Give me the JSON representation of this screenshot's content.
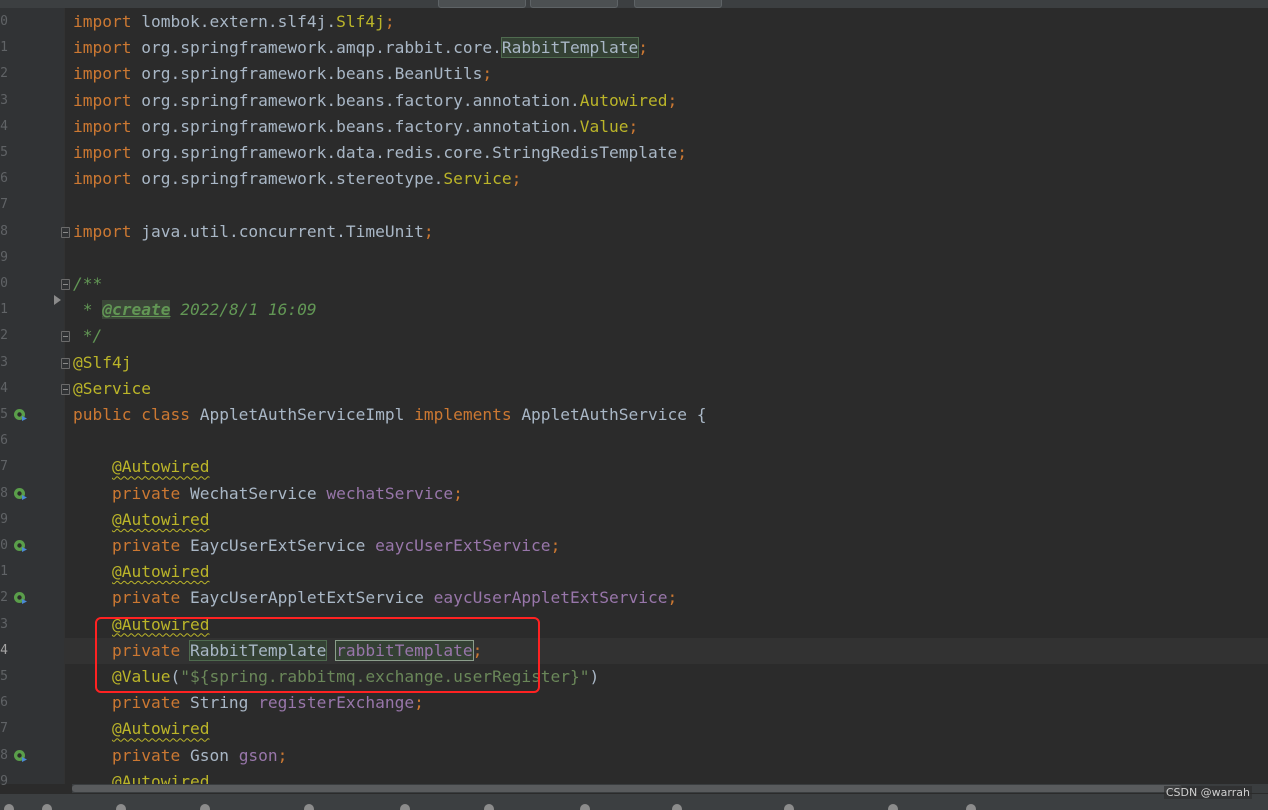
{
  "editor": {
    "line_digits": [
      "0",
      "1",
      "2",
      "3",
      "4",
      "5",
      "6",
      "7",
      "8",
      "9",
      "0",
      "1",
      "2",
      "3",
      "4",
      "5",
      "6",
      "7",
      "8",
      "9",
      "0",
      "1",
      "2",
      "3",
      "4",
      "5",
      "6",
      "7",
      "8",
      "9"
    ],
    "lines": [
      [
        {
          "t": "import ",
          "c": "kw"
        },
        {
          "t": "lombok.extern.slf4j.",
          "c": "plain"
        },
        {
          "t": "Slf4j",
          "c": "ann"
        },
        {
          "t": ";",
          "c": "kw"
        }
      ],
      [
        {
          "t": "import ",
          "c": "kw"
        },
        {
          "t": "org.springframework.amqp.rabbit.core.",
          "c": "plain"
        },
        {
          "t": "RabbitTemplate",
          "c": "plain hl"
        },
        {
          "t": ";",
          "c": "kw"
        }
      ],
      [
        {
          "t": "import ",
          "c": "kw"
        },
        {
          "t": "org.springframework.beans.BeanUtils",
          "c": "plain"
        },
        {
          "t": ";",
          "c": "kw"
        }
      ],
      [
        {
          "t": "import ",
          "c": "kw"
        },
        {
          "t": "org.springframework.beans.factory.annotation.",
          "c": "plain"
        },
        {
          "t": "Autowired",
          "c": "ann"
        },
        {
          "t": ";",
          "c": "kw"
        }
      ],
      [
        {
          "t": "import ",
          "c": "kw"
        },
        {
          "t": "org.springframework.beans.factory.annotation.",
          "c": "plain"
        },
        {
          "t": "Value",
          "c": "ann"
        },
        {
          "t": ";",
          "c": "kw"
        }
      ],
      [
        {
          "t": "import ",
          "c": "kw"
        },
        {
          "t": "org.springframework.data.redis.core.StringRedisTemplate",
          "c": "plain"
        },
        {
          "t": ";",
          "c": "kw"
        }
      ],
      [
        {
          "t": "import ",
          "c": "kw"
        },
        {
          "t": "org.springframework.stereotype.",
          "c": "plain"
        },
        {
          "t": "Service",
          "c": "ann"
        },
        {
          "t": ";",
          "c": "kw"
        }
      ],
      [],
      [
        {
          "t": "import ",
          "c": "kw"
        },
        {
          "t": "java.util.concurrent.TimeUnit",
          "c": "plain"
        },
        {
          "t": ";",
          "c": "kw"
        }
      ],
      [],
      [
        {
          "t": "/**",
          "c": "doc"
        }
      ],
      [
        {
          "t": " * ",
          "c": "doc"
        },
        {
          "t": "@create",
          "c": "doctag"
        },
        {
          "t": " 2022/8/1 16:09",
          "c": "doc"
        }
      ],
      [
        {
          "t": " */",
          "c": "doc"
        }
      ],
      [
        {
          "t": "@Slf4j",
          "c": "ann"
        }
      ],
      [
        {
          "t": "@Service",
          "c": "ann"
        }
      ],
      [
        {
          "t": "public class ",
          "c": "kw"
        },
        {
          "t": "AppletAuthServiceImpl ",
          "c": "plain"
        },
        {
          "t": "implements ",
          "c": "kw"
        },
        {
          "t": "AppletAuthService {",
          "c": "plain"
        }
      ],
      [],
      [
        {
          "t": "    ",
          "c": "plain"
        },
        {
          "t": "@Autowired",
          "c": "ann-u"
        }
      ],
      [
        {
          "t": "    ",
          "c": "plain"
        },
        {
          "t": "private ",
          "c": "kw"
        },
        {
          "t": "WechatService ",
          "c": "plain"
        },
        {
          "t": "wechatService",
          "c": "field"
        },
        {
          "t": ";",
          "c": "kw"
        }
      ],
      [
        {
          "t": "    ",
          "c": "plain"
        },
        {
          "t": "@Autowired",
          "c": "ann-u"
        }
      ],
      [
        {
          "t": "    ",
          "c": "plain"
        },
        {
          "t": "private ",
          "c": "kw"
        },
        {
          "t": "EaycUserExtService ",
          "c": "plain"
        },
        {
          "t": "eaycUserExtService",
          "c": "field"
        },
        {
          "t": ";",
          "c": "kw"
        }
      ],
      [
        {
          "t": "    ",
          "c": "plain"
        },
        {
          "t": "@Autowired",
          "c": "ann-u"
        }
      ],
      [
        {
          "t": "    ",
          "c": "plain"
        },
        {
          "t": "private ",
          "c": "kw"
        },
        {
          "t": "EaycUserAppletExtService ",
          "c": "plain"
        },
        {
          "t": "eaycUserAppletExtService",
          "c": "field"
        },
        {
          "t": ";",
          "c": "kw"
        }
      ],
      [
        {
          "t": "    ",
          "c": "plain"
        },
        {
          "t": "@Autowired",
          "c": "ann-u"
        }
      ],
      [
        {
          "t": "    ",
          "c": "plain"
        },
        {
          "t": "private ",
          "c": "kw"
        },
        {
          "t": "RabbitTemplate",
          "c": "plain hl"
        },
        {
          "t": " ",
          "c": "plain"
        },
        {
          "t": "rabbitTemplate",
          "c": "field hl-box"
        },
        {
          "t": ";",
          "c": "kw"
        }
      ],
      [
        {
          "t": "    ",
          "c": "plain"
        },
        {
          "t": "@Value",
          "c": "ann"
        },
        {
          "t": "(",
          "c": "plain"
        },
        {
          "t": "\"${spring.rabbitmq.exchange.userRegister}\"",
          "c": "str"
        },
        {
          "t": ")",
          "c": "plain"
        }
      ],
      [
        {
          "t": "    ",
          "c": "plain"
        },
        {
          "t": "private ",
          "c": "kw"
        },
        {
          "t": "String ",
          "c": "plain"
        },
        {
          "t": "registerExchange",
          "c": "field"
        },
        {
          "t": ";",
          "c": "kw"
        }
      ],
      [
        {
          "t": "    ",
          "c": "plain"
        },
        {
          "t": "@Autowired",
          "c": "ann-u"
        }
      ],
      [
        {
          "t": "    ",
          "c": "plain"
        },
        {
          "t": "private ",
          "c": "kw"
        },
        {
          "t": "Gson ",
          "c": "plain"
        },
        {
          "t": "gson",
          "c": "field"
        },
        {
          "t": ";",
          "c": "kw"
        }
      ],
      [
        {
          "t": "    ",
          "c": "plain"
        },
        {
          "t": "@Autowired",
          "c": "ann-u"
        }
      ]
    ]
  },
  "watermark": "CSDN @warrah",
  "colors": {
    "keyword": "#cc7832",
    "annotation": "#bbb529",
    "field": "#9876aa",
    "string": "#6a8759",
    "comment": "#629755",
    "highlight_box": "#ff2222"
  }
}
